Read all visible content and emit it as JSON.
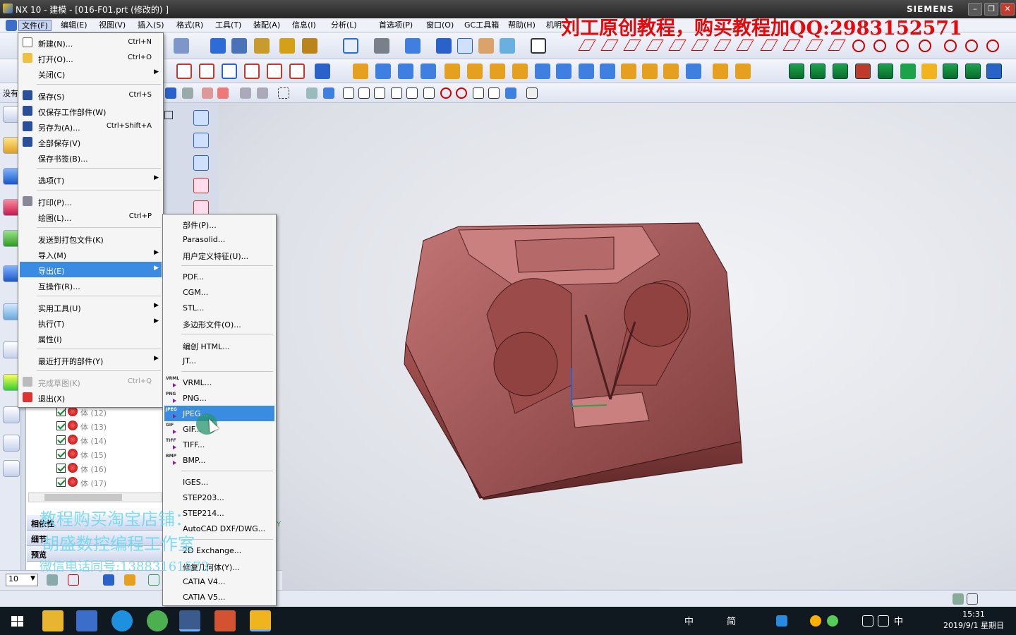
{
  "window": {
    "title": "NX 10 - 建模 - [016-F01.prt  (修改的) ]",
    "brand": "SIEMENS",
    "min": "–",
    "max": "❐",
    "close": "✕"
  },
  "menubar": [
    "文件(F)",
    "编辑(E)",
    "视图(V)",
    "插入(S)",
    "格式(R)",
    "工具(T)",
    "装配(A)",
    "信息(I)",
    "分析(L)",
    "首选项(P)",
    "窗口(O)",
    "GC工具箱",
    "帮助(H)",
    "机明"
  ],
  "banner": "刘工原创教程，购买教程加QQ:2983152571",
  "left_label": "没有",
  "file_menu": [
    {
      "label": "新建(N)...",
      "shortcut": "Ctrl+N",
      "icon": "new-file-icon"
    },
    {
      "label": "打开(O)...",
      "shortcut": "Ctrl+O",
      "icon": "open-folder-icon"
    },
    {
      "label": "关闭(C)",
      "arrow": "▶"
    },
    {
      "label": "保存(S)",
      "shortcut": "Ctrl+S",
      "icon": "save-icon"
    },
    {
      "label": "仅保存工作部件(W)",
      "icon": "save-work-icon"
    },
    {
      "label": "另存为(A)...",
      "shortcut": "Ctrl+Shift+A",
      "icon": "save-as-icon"
    },
    {
      "label": "全部保存(V)",
      "icon": "save-all-icon"
    },
    {
      "label": "保存书签(B)..."
    },
    {
      "label": "选项(T)",
      "arrow": "▶"
    },
    {
      "label": "打印(P)...",
      "icon": "print-icon"
    },
    {
      "label": "绘图(L)...",
      "shortcut": "Ctrl+P"
    },
    {
      "label": "发送到打包文件(K)"
    },
    {
      "label": "导入(M)",
      "arrow": "▶"
    },
    {
      "label": "导出(E)",
      "arrow": "▶"
    },
    {
      "label": "互操作(R)..."
    },
    {
      "label": "实用工具(U)",
      "arrow": "▶"
    },
    {
      "label": "执行(T)",
      "arrow": "▶"
    },
    {
      "label": "属性(I)"
    },
    {
      "label": "最近打开的部件(Y)",
      "arrow": "▶"
    },
    {
      "label": "完成草图(K)",
      "shortcut": "Ctrl+Q",
      "icon": "finish-sketch-icon"
    },
    {
      "label": "退出(X)",
      "icon": "exit-icon"
    }
  ],
  "export_menu": [
    {
      "label": "部件(P)..."
    },
    {
      "label": "Parasolid..."
    },
    {
      "label": "用户定义特征(U)..."
    },
    {
      "label": "PDF..."
    },
    {
      "label": "CGM..."
    },
    {
      "label": "STL..."
    },
    {
      "label": "多边形文件(O)..."
    },
    {
      "label": "编创 HTML..."
    },
    {
      "label": "JT..."
    },
    {
      "label": "VRML...",
      "tag": "VRML"
    },
    {
      "label": "PNG...",
      "tag": "PNG"
    },
    {
      "label": "JPEG...",
      "tag": "JPEG"
    },
    {
      "label": "GIF...",
      "tag": "GIF"
    },
    {
      "label": "TIFF...",
      "tag": "TIFF"
    },
    {
      "label": "BMP...",
      "tag": "BMP"
    },
    {
      "label": "IGES..."
    },
    {
      "label": "STEP203..."
    },
    {
      "label": "STEP214..."
    },
    {
      "label": "AutoCAD DXF/DWG..."
    },
    {
      "label": "2D Exchange..."
    },
    {
      "label": "修复几何体(Y)..."
    },
    {
      "label": "CATIA V4..."
    },
    {
      "label": "CATIA V5..."
    }
  ],
  "part_navigator": {
    "bodies": [
      "体 (12)",
      "体 (13)",
      "体 (14)",
      "体 (15)",
      "体 (16)",
      "体 (17)"
    ],
    "sections": [
      "相依性",
      "细节",
      "预览"
    ]
  },
  "watermark": {
    "line1": "教程购买淘宝店铺：",
    "line2": "胡盛数控编程工作室",
    "line3": "微信电话同号:13883161573"
  },
  "selection_filter": "10",
  "triad_label": "Y",
  "taskbar": {
    "tray_text": [
      "中",
      "简",
      "中"
    ],
    "time": "15:31",
    "date": "2019/9/1 星期日"
  },
  "colors": {
    "menu_highlight": "#3a8be2",
    "banner": "#e8080a",
    "part": "#b0605e"
  }
}
